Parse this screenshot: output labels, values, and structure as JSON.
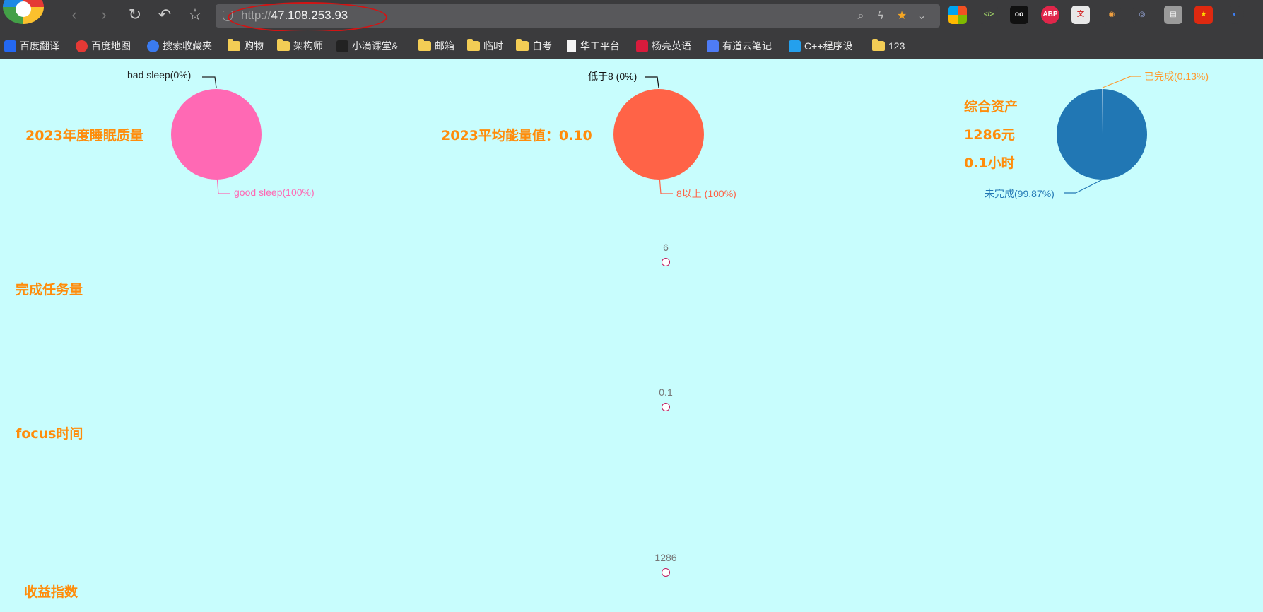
{
  "browser": {
    "url_scheme": "http://",
    "url_host": "47.108.253.93",
    "bookmarks": [
      {
        "label": "百度翻译",
        "icon": "translate-icon",
        "color": "#2468f2"
      },
      {
        "label": "百度地图",
        "icon": "map-pin-icon",
        "color": "#e53935"
      },
      {
        "label": "搜索收藏夹",
        "icon": "star-icon",
        "color": "#3a7bf0"
      },
      {
        "label": "购物",
        "icon": "folder-icon"
      },
      {
        "label": "架构师",
        "icon": "folder-icon"
      },
      {
        "label": "小滴课堂&",
        "icon": "site-icon",
        "color": "#222222"
      },
      {
        "label": "邮箱",
        "icon": "folder-icon"
      },
      {
        "label": "临时",
        "icon": "folder-icon"
      },
      {
        "label": "自考",
        "icon": "folder-icon"
      },
      {
        "label": "华工平台",
        "icon": "document-icon"
      },
      {
        "label": "杨亮英语",
        "icon": "site-icon",
        "color": "#d81b3c"
      },
      {
        "label": "有道云笔记",
        "icon": "note-icon",
        "color": "#4e7cf6"
      },
      {
        "label": "C++程序设",
        "icon": "site-icon",
        "color": "#24a0ed"
      },
      {
        "label": "123",
        "icon": "folder-icon"
      }
    ],
    "extensions": [
      {
        "name": "windows-grid-extension",
        "text": ""
      },
      {
        "name": "code-extension",
        "text": "</>"
      },
      {
        "name": "owl-extension",
        "text": "oo"
      },
      {
        "name": "adblock-extension",
        "text": "ABP"
      },
      {
        "name": "translator-extension",
        "text": "文"
      },
      {
        "name": "monkey-extension",
        "text": "◉"
      },
      {
        "name": "spy-extension",
        "text": "◎"
      },
      {
        "name": "reader-extension",
        "text": "▤"
      },
      {
        "name": "china-flag-extension",
        "text": "★"
      },
      {
        "name": "sync-extension",
        "text": "◐"
      }
    ]
  },
  "sleep": {
    "title": "2023年度睡眠质量",
    "slices": [
      {
        "label": "bad sleep(0%)",
        "value": 0,
        "color": "#222222"
      },
      {
        "label": "good sleep(100%)",
        "value": 100,
        "color": "#ff69b4"
      }
    ]
  },
  "energy": {
    "title": "2023平均能量值：0.10",
    "slices": [
      {
        "label": "低于8 (0%)",
        "value": 0,
        "color": "#111111"
      },
      {
        "label": "8以上 (100%)",
        "value": 100,
        "color": "#ff6347"
      }
    ]
  },
  "assets": {
    "lines": [
      "综合资产",
      "1286元",
      "0.1小时"
    ],
    "slices": [
      {
        "label": "已完成(0.13%)",
        "value": 0.13,
        "color": "#ff9a2e"
      },
      {
        "label": "未完成(99.87%)",
        "value": 99.87,
        "color": "#2177b4"
      }
    ]
  },
  "metrics": [
    {
      "title": "完成任务量",
      "point_label": "6"
    },
    {
      "title": "focus时间",
      "point_label": "0.1"
    },
    {
      "title": "收益指数",
      "point_label": "1286"
    }
  ]
}
